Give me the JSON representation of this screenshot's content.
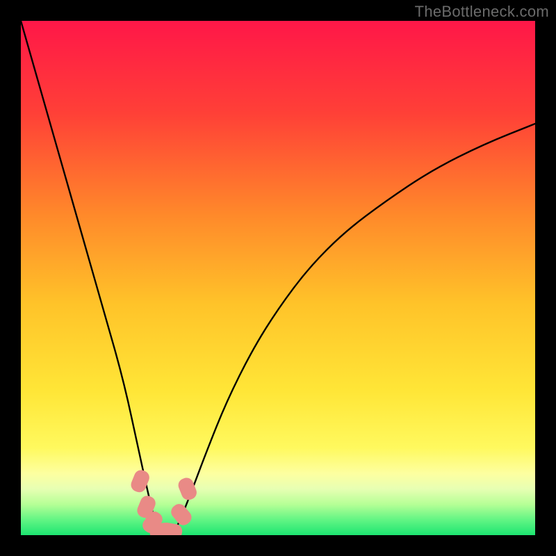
{
  "watermark": "TheBottleneck.com",
  "chart_data": {
    "type": "line",
    "title": "",
    "xlabel": "",
    "ylabel": "",
    "xlim": [
      0,
      100
    ],
    "ylim": [
      0,
      100
    ],
    "series": [
      {
        "name": "bottleneck-curve",
        "x": [
          0,
          4,
          8,
          12,
          16,
          20,
          23,
          25,
          26,
          27,
          28,
          29,
          30,
          31,
          33,
          36,
          40,
          45,
          50,
          56,
          63,
          71,
          80,
          90,
          100
        ],
        "values": [
          100,
          86,
          72,
          58,
          44,
          30,
          16,
          7,
          3,
          1,
          0,
          0,
          1,
          3,
          8,
          16,
          26,
          36,
          44,
          52,
          59,
          65,
          71,
          76,
          80
        ]
      }
    ],
    "markers": {
      "name": "highlight-segment",
      "color": "#e98a86",
      "points_x": [
        23.2,
        24.4,
        25.6,
        27.2,
        29.2,
        31.2,
        32.4
      ],
      "points_y": [
        10.5,
        5.5,
        2.5,
        0.8,
        0.8,
        4.0,
        9.0
      ]
    },
    "background_gradient": {
      "stops": [
        {
          "offset": 0.0,
          "color": "#ff1748"
        },
        {
          "offset": 0.18,
          "color": "#ff4037"
        },
        {
          "offset": 0.38,
          "color": "#ff8a2a"
        },
        {
          "offset": 0.55,
          "color": "#ffc329"
        },
        {
          "offset": 0.72,
          "color": "#ffe637"
        },
        {
          "offset": 0.83,
          "color": "#fff95e"
        },
        {
          "offset": 0.88,
          "color": "#fdffa0"
        },
        {
          "offset": 0.91,
          "color": "#e7ffb3"
        },
        {
          "offset": 0.94,
          "color": "#b6ff96"
        },
        {
          "offset": 0.97,
          "color": "#62f584"
        },
        {
          "offset": 1.0,
          "color": "#1de571"
        }
      ]
    }
  }
}
